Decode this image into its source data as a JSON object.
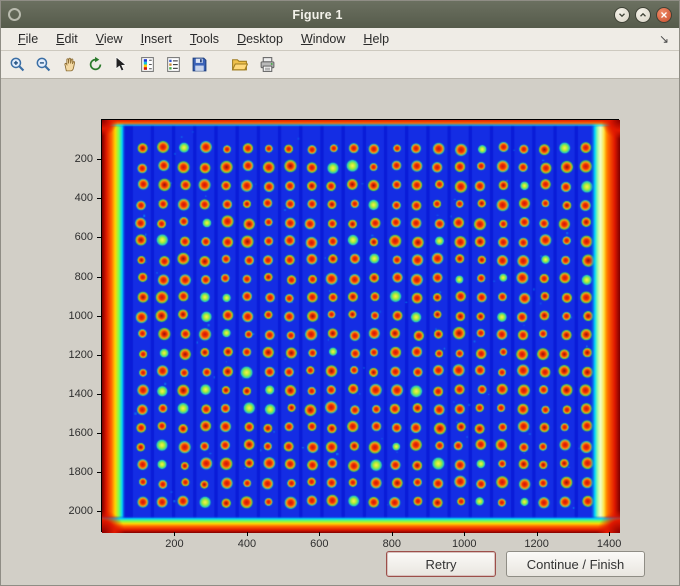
{
  "window": {
    "title": "Figure 1",
    "controls": [
      {
        "name": "window-menu-button",
        "icon": "circle-icon"
      },
      {
        "name": "minimize-button",
        "icon": "chevron-down-icon"
      },
      {
        "name": "maximize-button",
        "icon": "chevron-up-icon"
      },
      {
        "name": "close-button",
        "icon": "close-x-icon"
      }
    ]
  },
  "menubar": {
    "items": [
      {
        "label": "File",
        "mnemonic": 0
      },
      {
        "label": "Edit",
        "mnemonic": 0
      },
      {
        "label": "View",
        "mnemonic": 0
      },
      {
        "label": "Insert",
        "mnemonic": 0
      },
      {
        "label": "Tools",
        "mnemonic": 0
      },
      {
        "label": "Desktop",
        "mnemonic": 0
      },
      {
        "label": "Window",
        "mnemonic": 0
      },
      {
        "label": "Help",
        "mnemonic": 0
      }
    ],
    "dock_arrow": "↘"
  },
  "toolbar": {
    "buttons": [
      {
        "name": "zoom-in"
      },
      {
        "name": "zoom-out"
      },
      {
        "name": "pan"
      },
      {
        "name": "rotate-3d"
      },
      {
        "name": "data-cursor"
      },
      {
        "name": "insert-colorbar"
      },
      {
        "name": "insert-legend"
      },
      {
        "name": "save-figure"
      },
      {
        "name": "open-file",
        "group": 2
      },
      {
        "name": "print-figure",
        "group": 2
      }
    ]
  },
  "buttons": {
    "retry": "Retry",
    "continue_finish": "Continue / Finish"
  },
  "chart_data": {
    "type": "heatmap",
    "title": "",
    "description": "Microarray plate image rendered with jet colormap: deep blue background, regular grid of red/orange spots with green-cyan halos, saturated red borders along all four plate edges",
    "x_range": [
      0,
      1430
    ],
    "y_range": [
      0,
      2110
    ],
    "x_ticks": [
      200,
      400,
      600,
      800,
      1000,
      1200,
      1400
    ],
    "y_ticks": [
      200,
      400,
      600,
      800,
      1000,
      1200,
      1400,
      1600,
      1800,
      2000
    ],
    "grid": {
      "rows": 20,
      "cols": 22,
      "x0": 110,
      "y0": 145,
      "dx": 58.5,
      "dy": 95,
      "spot_radius": 10
    },
    "colors": {
      "background": "#0a1cd8",
      "stripe": "rgba(45,85,255,0.30)",
      "spot_center": "#cc1111",
      "spot_center_dark": "#8a0f0f",
      "spot_mid": "#ee3300",
      "spot_ring": "#ff9911",
      "spot_halo_green": "#44cc55",
      "spot_halo_cyan": "#22bbaa",
      "green_spot": [
        "#ffee55",
        "#aaee33",
        "#22ccbb"
      ],
      "edge_stops": [
        "#7a0000",
        "#e01800",
        "#ff6a00",
        "#ffd800",
        "#7dff50",
        "#00d8ff"
      ],
      "axis_text": "#2e2e2e"
    },
    "seed": 42,
    "grid_lines": false,
    "legend": false
  }
}
